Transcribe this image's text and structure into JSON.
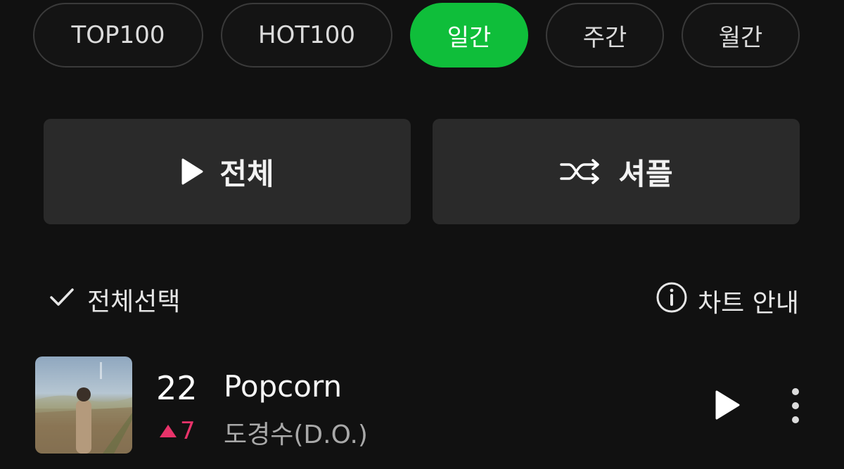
{
  "tabs": [
    {
      "label": "TOP100",
      "active": false
    },
    {
      "label": "HOT100",
      "active": false
    },
    {
      "label": "일간",
      "active": true
    },
    {
      "label": "주간",
      "active": false
    },
    {
      "label": "월간",
      "active": false
    }
  ],
  "actions": {
    "play_all_label": "전체",
    "play_all_icon": "play-icon",
    "shuffle_label": "셔플",
    "shuffle_icon": "shuffle-icon"
  },
  "list_controls": {
    "select_all_label": "전체선택",
    "select_all_icon": "check-icon",
    "chart_guide_label": "차트 안내",
    "chart_guide_icon": "info-icon"
  },
  "songs": [
    {
      "rank": "22",
      "rank_change": "7",
      "rank_change_direction": "up",
      "title": "Popcorn",
      "artist": "도경수(D.O.)"
    }
  ],
  "colors": {
    "accent": "#0fbe3a",
    "rank_up": "#e8336a",
    "background": "#111111"
  }
}
